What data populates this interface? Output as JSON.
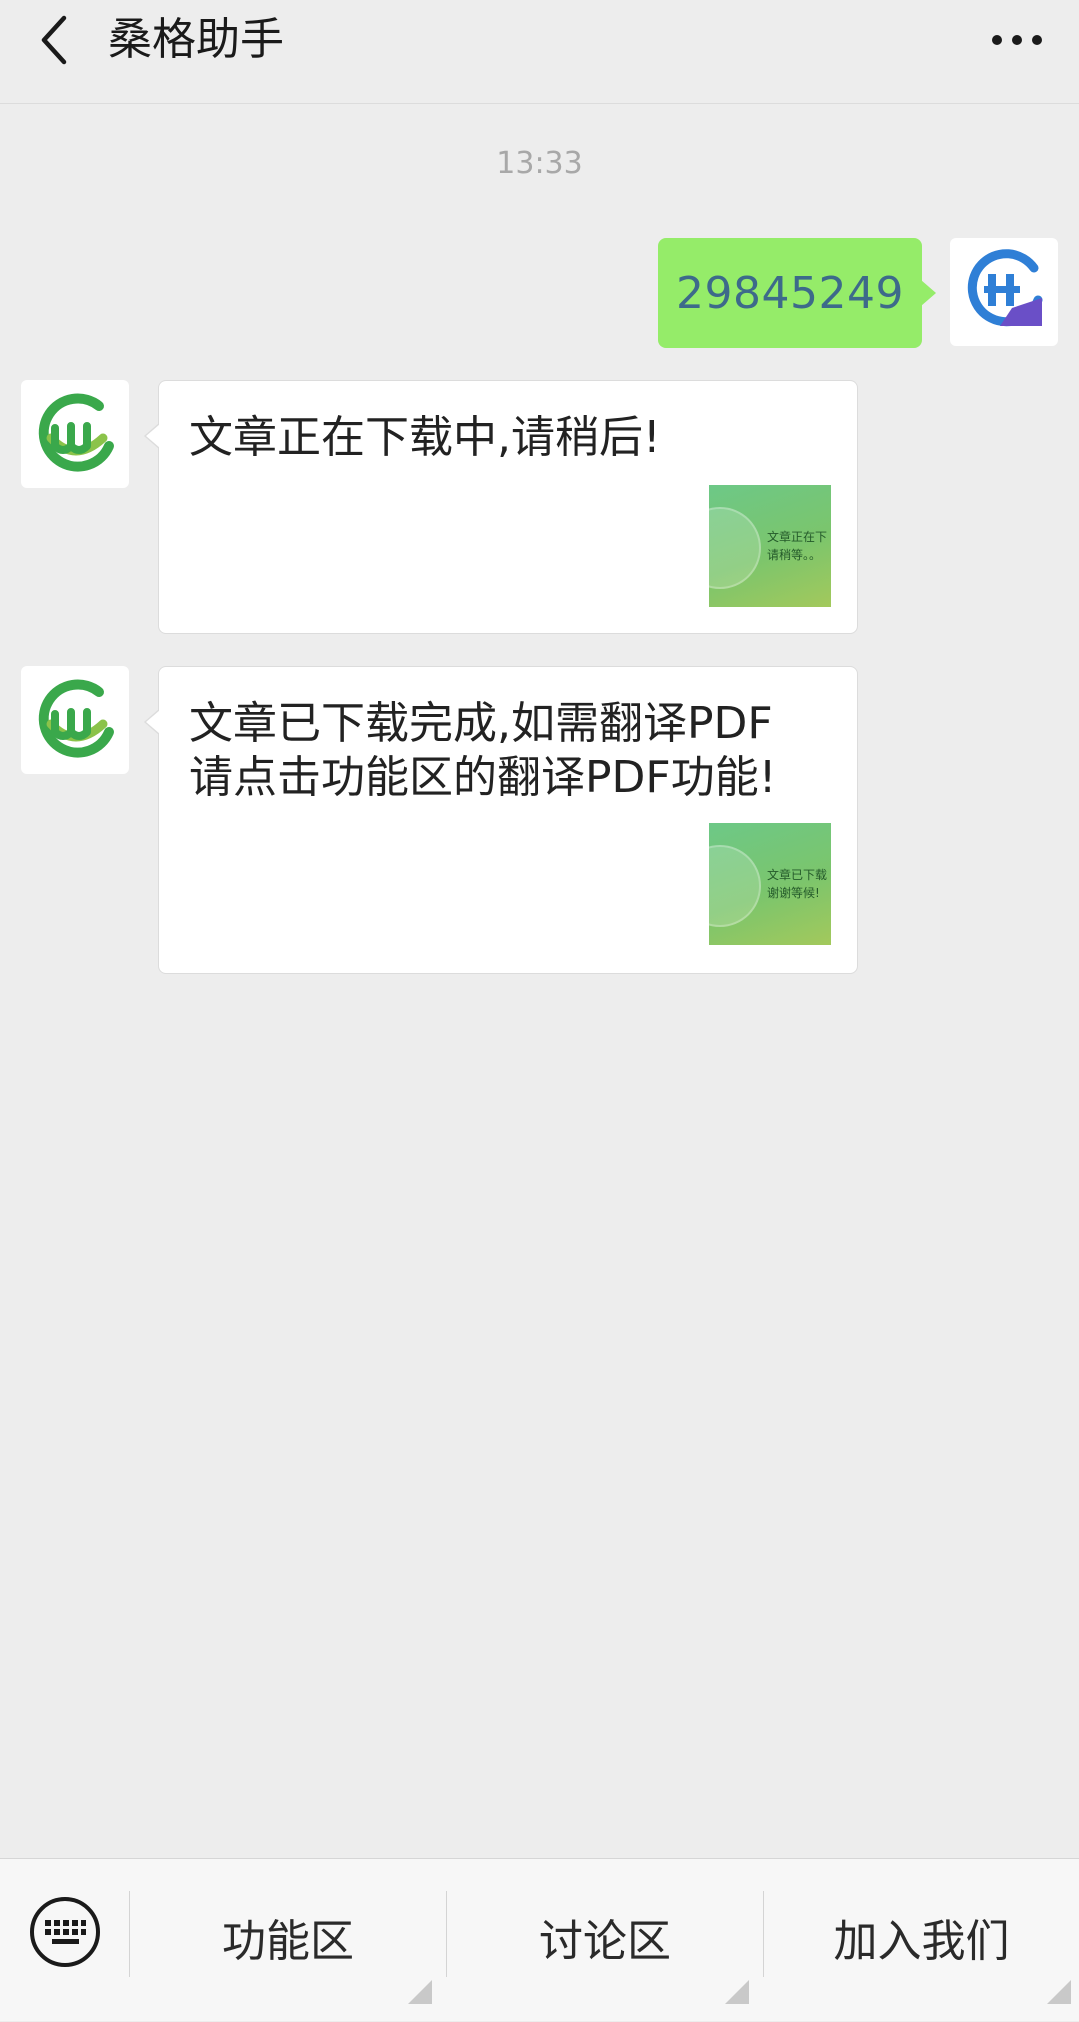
{
  "header": {
    "title": "桑格助手",
    "back_icon": "chevron-left-icon",
    "more_icon": "more-horizontal-icon"
  },
  "chat": {
    "timestamp": "13:33",
    "sent_message": {
      "text": "29845249",
      "bubble_color": "#95ec69"
    },
    "received_messages": [
      {
        "text": "文章正在下载中,请稍后!",
        "thumbnail_lines": [
          "文章正在下",
          "请稍等。。"
        ]
      },
      {
        "text": "文章已下载完成,如需翻译PDF请点击功能区的翻译PDF功能!",
        "thumbnail_lines": [
          "文章已下载",
          "谢谢等候!"
        ]
      }
    ]
  },
  "menu": {
    "keyboard_icon": "keyboard-icon",
    "items": [
      {
        "label": "功能区"
      },
      {
        "label": "讨论区"
      },
      {
        "label": "加入我们"
      }
    ]
  },
  "colors": {
    "background": "#ededed",
    "bot_logo_green": "#3aa84b",
    "user_logo_blue": "#2f7fd6",
    "user_logo_purple": "#6a4fc7"
  }
}
